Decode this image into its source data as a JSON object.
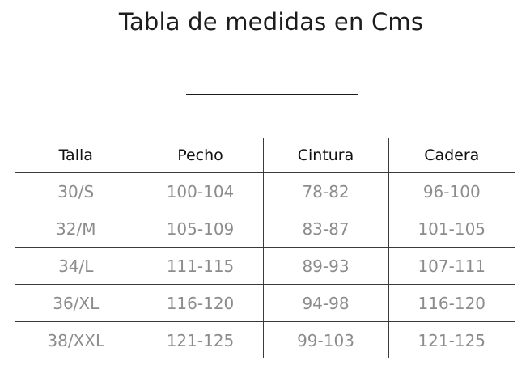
{
  "title": "Tabla de medidas en Cms",
  "table": {
    "headers": [
      "Talla",
      "Pecho",
      "Cintura",
      "Cadera"
    ],
    "rows": [
      [
        "30/S",
        "100-104",
        "78-82",
        "96-100"
      ],
      [
        "32/M",
        "105-109",
        "83-87",
        "101-105"
      ],
      [
        "34/L",
        "111-115",
        "89-93",
        "107-111"
      ],
      [
        "36/XL",
        "116-120",
        "94-98",
        "116-120"
      ],
      [
        "38/XXL",
        "121-125",
        "99-103",
        "121-125"
      ]
    ]
  },
  "colors": {
    "heading_text": "#1c1c1c",
    "cell_text": "#8c8c8c",
    "rule": "#3a3a3a"
  }
}
